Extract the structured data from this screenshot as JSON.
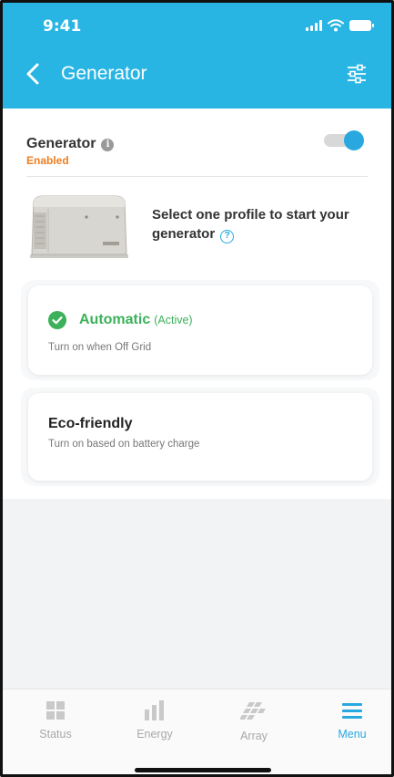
{
  "status_bar": {
    "time": "9:41"
  },
  "header": {
    "title": "Generator"
  },
  "generator": {
    "label": "Generator",
    "status": "Enabled",
    "toggle_on": true,
    "select_prompt": "Select one profile to start your generator"
  },
  "profiles": [
    {
      "title": "Automatic",
      "tag": "(Active)",
      "description": "Turn on when Off Grid",
      "active": true
    },
    {
      "title": "Eco-friendly",
      "tag": "",
      "description": "Turn on based on battery charge",
      "active": false
    }
  ],
  "tabs": [
    {
      "label": "Status",
      "icon": "grid-icon",
      "active": false
    },
    {
      "label": "Energy",
      "icon": "bar-chart-icon",
      "active": false
    },
    {
      "label": "Array",
      "icon": "solar-panels-icon",
      "active": false
    },
    {
      "label": "Menu",
      "icon": "menu-icon",
      "active": true
    }
  ],
  "colors": {
    "header": "#29b5e3",
    "accent": "#29a8e0",
    "enabled": "#f07d1f",
    "active": "#3cb15a"
  }
}
